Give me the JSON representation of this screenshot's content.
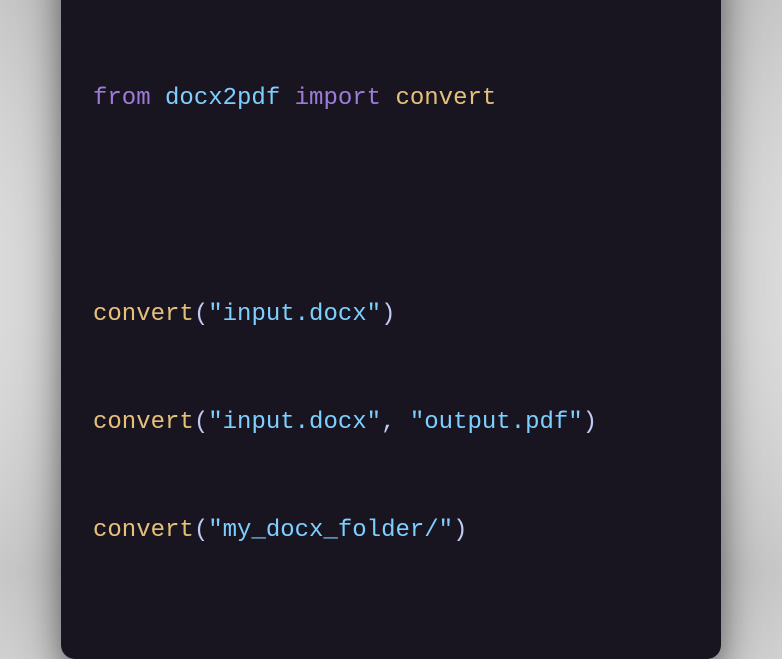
{
  "window": {
    "dots": [
      "red",
      "yellow",
      "green"
    ]
  },
  "code": {
    "line1": {
      "kw1": "from",
      "mod": "docx2pdf",
      "kw2": "import",
      "name": "convert"
    },
    "line2": {
      "fn": "convert",
      "open": "(",
      "arg1": "\"input.docx\"",
      "close": ")"
    },
    "line3": {
      "fn": "convert",
      "open": "(",
      "arg1": "\"input.docx\"",
      "sep": ", ",
      "arg2": "\"output.pdf\"",
      "close": ")"
    },
    "line4": {
      "fn": "convert",
      "open": "(",
      "arg1": "\"my_docx_folder/\"",
      "close": ")"
    }
  }
}
